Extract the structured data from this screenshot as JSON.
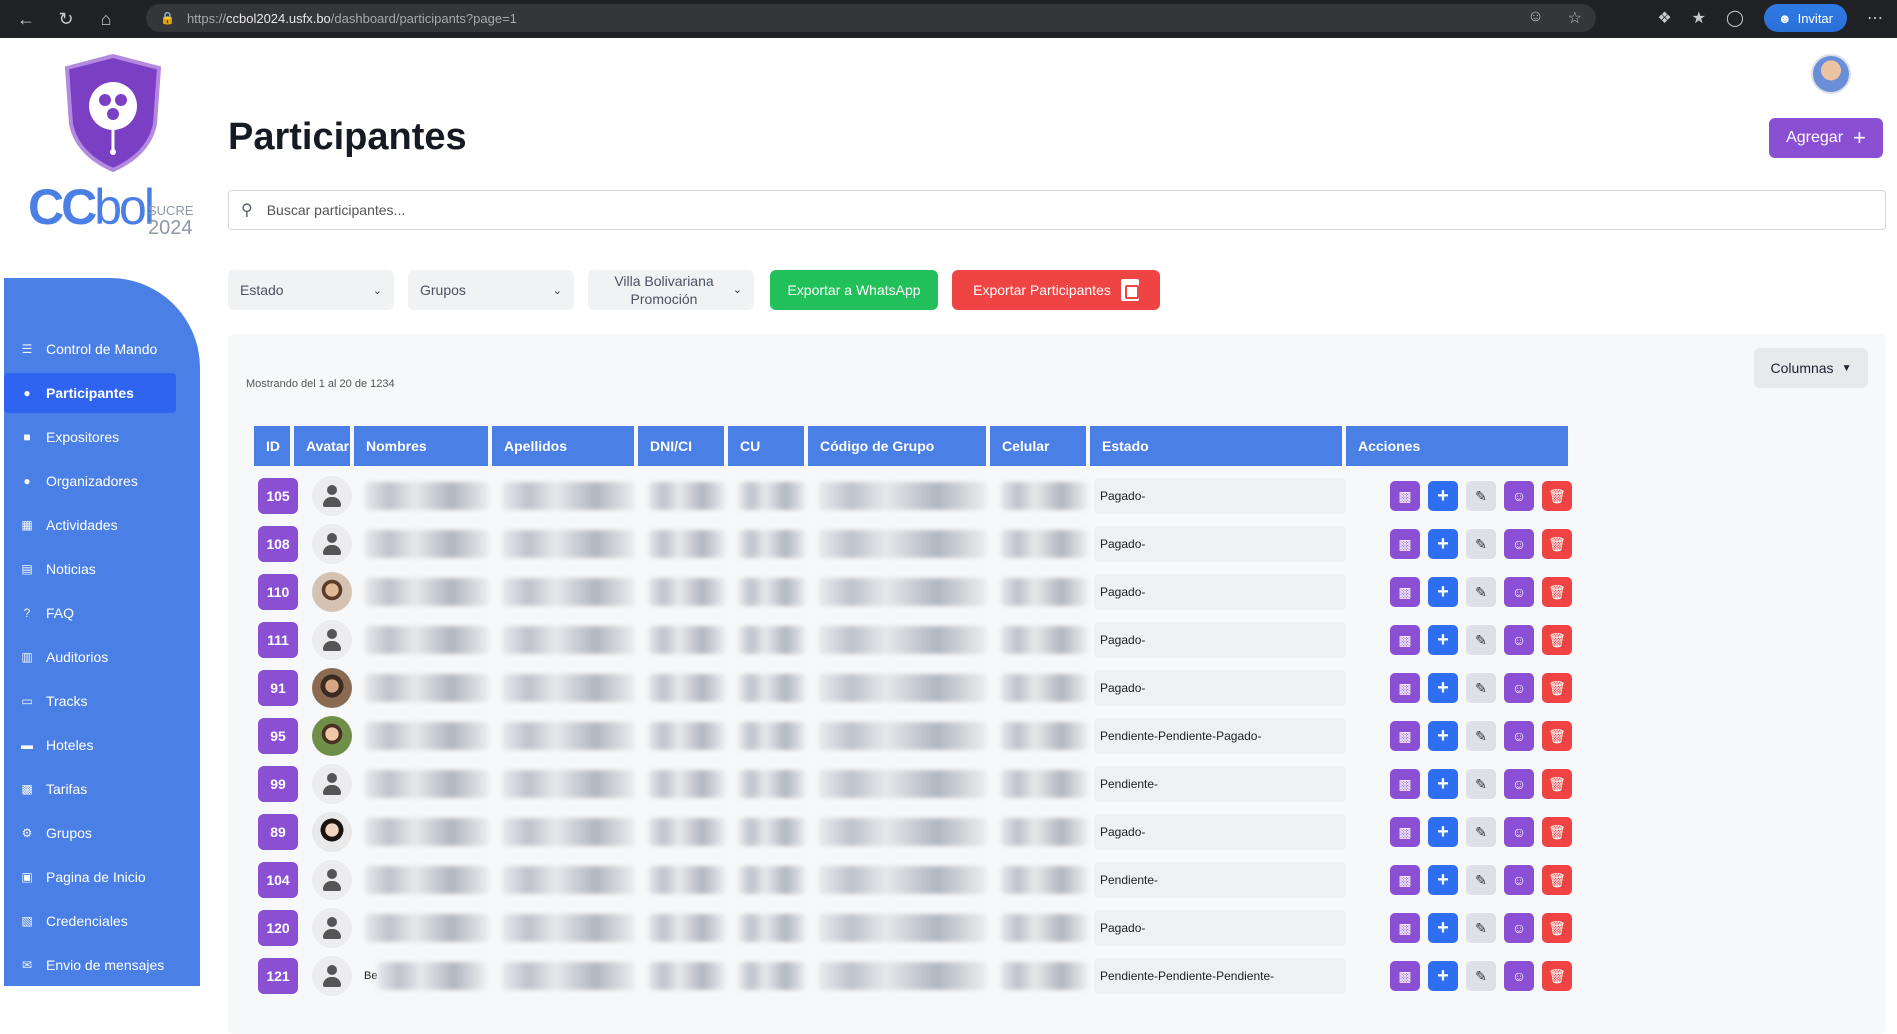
{
  "browser": {
    "url_prefix": "https://",
    "url_host": "ccbol2024.usfx.bo",
    "url_path": "/dashboard/participants?page=1",
    "invite_label": "Invitar"
  },
  "logo": {
    "brand_c": "CC",
    "brand_b": "bol",
    "sub_city": "SUCRE",
    "sub_year": "2024"
  },
  "sidebar": {
    "items": [
      {
        "label": "Control de Mando",
        "icon": "list-icon"
      },
      {
        "label": "Participantes",
        "icon": "user-icon"
      },
      {
        "label": "Expositores",
        "icon": "presenter-icon"
      },
      {
        "label": "Organizadores",
        "icon": "users-icon"
      },
      {
        "label": "Actividades",
        "icon": "calendar-icon"
      },
      {
        "label": "Noticias",
        "icon": "newspaper-icon"
      },
      {
        "label": "FAQ",
        "icon": "question-icon"
      },
      {
        "label": "Auditorios",
        "icon": "building-icon"
      },
      {
        "label": "Tracks",
        "icon": "tracks-icon"
      },
      {
        "label": "Hoteles",
        "icon": "bed-icon"
      },
      {
        "label": "Tarifas",
        "icon": "money-icon"
      },
      {
        "label": "Grupos",
        "icon": "group-icon"
      },
      {
        "label": "Pagina de Inicio",
        "icon": "home-page-icon"
      },
      {
        "label": "Credenciales",
        "icon": "badge-icon"
      },
      {
        "label": "Envio de mensajes",
        "icon": "message-icon"
      }
    ]
  },
  "header": {
    "title": "Participantes",
    "add_label": "Agregar"
  },
  "search": {
    "placeholder": "Buscar participantes..."
  },
  "filters": {
    "estado": "Estado",
    "grupos": "Grupos",
    "sede_line1": "Villa Bolivariana",
    "sede_line2": "Promoción",
    "export_whatsapp": "Exportar a WhatsApp",
    "export_participants": "Exportar Participantes"
  },
  "table": {
    "showing": "Mostrando del 1 al 20 de 1234",
    "columns_button": "Columnas",
    "headers": [
      "ID",
      "Avatar",
      "Nombres",
      "Apellidos",
      "DNI/CI",
      "CU",
      "Código de Grupo",
      "Celular",
      "Estado",
      "Acciones"
    ],
    "rows": [
      {
        "id": "105",
        "estado": "Pagado-",
        "avatar": "default"
      },
      {
        "id": "108",
        "estado": "Pagado-",
        "avatar": "default"
      },
      {
        "id": "110",
        "estado": "Pagado-",
        "avatar": "photo"
      },
      {
        "id": "111",
        "estado": "Pagado-",
        "avatar": "default"
      },
      {
        "id": "91",
        "estado": "Pagado-",
        "avatar": "photo2"
      },
      {
        "id": "95",
        "estado": "Pendiente-Pendiente-Pagado-",
        "avatar": "photo3"
      },
      {
        "id": "99",
        "estado": "Pendiente-",
        "avatar": "default"
      },
      {
        "id": "89",
        "estado": "Pagado-",
        "avatar": "photo4"
      },
      {
        "id": "104",
        "estado": "Pendiente-",
        "avatar": "default"
      },
      {
        "id": "120",
        "estado": "Pagado-",
        "avatar": "default"
      },
      {
        "id": "121",
        "estado": "Pendiente-Pendiente-Pendiente-",
        "avatar": "default",
        "nombre_partial": "Be"
      }
    ]
  }
}
